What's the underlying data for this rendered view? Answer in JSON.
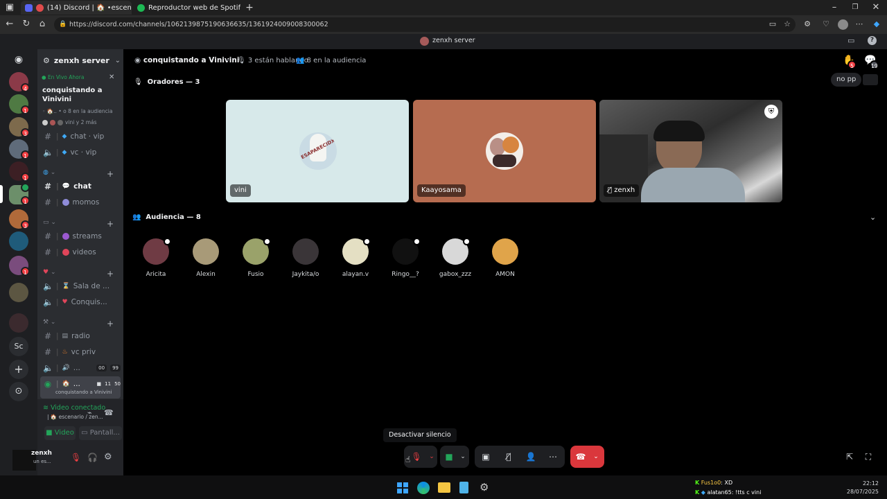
{
  "browser": {
    "tabs": [
      {
        "label": "(14) Discord | 🏠 •escenar",
        "active": true
      },
      {
        "label": "Reproductor web de Spotify: mú",
        "active": false
      }
    ],
    "url": "https://discord.com/channels/1062139875190636635/1361924009008300062",
    "new_tab": "+"
  },
  "discord_title": {
    "server_label": "zenxh server"
  },
  "guilds": {
    "badges": [
      "4",
      "1",
      "3",
      "1",
      "1",
      "1",
      "3",
      "1"
    ],
    "text_server": "Sc"
  },
  "sidebar": {
    "server_name": "zenxh server",
    "live_label": "En Vivo Ahora",
    "live_title": "conquistando a Vinivini",
    "live_audience": "• ο 8 en la audiencia",
    "live_more": "vini y 2 más",
    "channels": [
      {
        "label": "chat · vip"
      },
      {
        "label": "vc · vip"
      },
      {
        "label": "chat"
      },
      {
        "label": "momos"
      },
      {
        "label": "streams"
      },
      {
        "label": "videos"
      },
      {
        "label": "Sala de ..."
      },
      {
        "label": "Conquis..."
      },
      {
        "label": "radio"
      },
      {
        "label": "vc priv"
      },
      {
        "label": "..."
      },
      {
        "label": "..."
      }
    ],
    "vc_counts": [
      "00",
      "99"
    ],
    "stage_counts": [
      "11",
      "50"
    ],
    "stage_sub": "conquistando a Vinivini"
  },
  "voice_panel": {
    "status": "Video conectado",
    "location": "escenario / zen...",
    "video_btn": "Video",
    "screen_btn": "Pantall..."
  },
  "user_panel": {
    "name": "zenxh",
    "status": "un es..."
  },
  "stage": {
    "title": "conquistando a Vinivini",
    "speaking": "3 están hablando",
    "audience": "8 en la audiencia",
    "hand_badge": "5",
    "chat_badge": "19",
    "no_pp": "no pp",
    "speakers_header": "Oradores — 3",
    "speakers": [
      {
        "name": "vini",
        "bg": "#d7e9ea"
      },
      {
        "name": "Kaayosama",
        "bg": "#b66c50"
      },
      {
        "name": "zenxh",
        "bg": "#3b3b3b"
      }
    ],
    "vini_avatar_text": "ESAPARECIDX",
    "audience_header": "Audiencia — 8",
    "audience_members": [
      {
        "name": "Aricita",
        "color": "#6f3b44"
      },
      {
        "name": "Alexin",
        "color": "#a89a78"
      },
      {
        "name": "Fusio",
        "color": "#9aa26a"
      },
      {
        "name": "Jaykita/o",
        "color": "#3a3538"
      },
      {
        "name": "alayan.v",
        "color": "#e4dfc3"
      },
      {
        "name": "Ringo__?",
        "color": "#111111"
      },
      {
        "name": "gabox_zzz",
        "color": "#d8d8d8"
      },
      {
        "name": "AMON",
        "color": "#e0a44a"
      }
    ]
  },
  "controls": {
    "tooltip": "Desactivar silencio"
  },
  "taskbar": {
    "notif1_user": "Fus1o0",
    "notif1_msg": "XD",
    "notif2_user": "alatan65",
    "notif2_msg": "!tts c vini",
    "time": "22:12",
    "date": "28/07/2025"
  }
}
